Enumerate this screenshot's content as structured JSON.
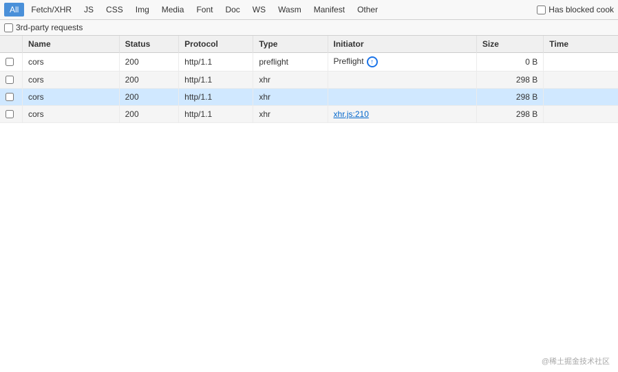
{
  "filterBar": {
    "tabs": [
      {
        "id": "all",
        "label": "All",
        "active": true
      },
      {
        "id": "fetch-xhr",
        "label": "Fetch/XHR",
        "active": false
      },
      {
        "id": "js",
        "label": "JS",
        "active": false
      },
      {
        "id": "css",
        "label": "CSS",
        "active": false
      },
      {
        "id": "img",
        "label": "Img",
        "active": false
      },
      {
        "id": "media",
        "label": "Media",
        "active": false
      },
      {
        "id": "font",
        "label": "Font",
        "active": false
      },
      {
        "id": "doc",
        "label": "Doc",
        "active": false
      },
      {
        "id": "ws",
        "label": "WS",
        "active": false
      },
      {
        "id": "wasm",
        "label": "Wasm",
        "active": false
      },
      {
        "id": "manifest",
        "label": "Manifest",
        "active": false
      },
      {
        "id": "other",
        "label": "Other",
        "active": false
      }
    ],
    "hasBlockedCookieLabel": "Has blocked cook",
    "thirdPartyLabel": "3rd-party requests"
  },
  "table": {
    "columns": [
      {
        "id": "name",
        "label": "Name"
      },
      {
        "id": "status",
        "label": "Status"
      },
      {
        "id": "protocol",
        "label": "Protocol"
      },
      {
        "id": "type",
        "label": "Type"
      },
      {
        "id": "initiator",
        "label": "Initiator"
      },
      {
        "id": "size",
        "label": "Size"
      },
      {
        "id": "time",
        "label": "Time"
      }
    ],
    "rows": [
      {
        "id": 1,
        "name": "cors",
        "status": "200",
        "protocol": "http/1.1",
        "type": "preflight",
        "initiator": "Preflight",
        "hasInitiatorIcon": true,
        "initiatorLink": null,
        "size": "0 B",
        "time": "",
        "highlighted": false
      },
      {
        "id": 2,
        "name": "cors",
        "status": "200",
        "protocol": "http/1.1",
        "type": "xhr",
        "initiator": "",
        "hasInitiatorIcon": false,
        "initiatorLink": null,
        "size": "298 B",
        "time": "",
        "highlighted": false
      },
      {
        "id": 3,
        "name": "cors",
        "status": "200",
        "protocol": "http/1.1",
        "type": "xhr",
        "initiator": "",
        "hasInitiatorIcon": false,
        "initiatorLink": null,
        "size": "298 B",
        "time": "",
        "highlighted": true
      },
      {
        "id": 4,
        "name": "cors",
        "status": "200",
        "protocol": "http/1.1",
        "type": "xhr",
        "initiator": "xhr.js:210",
        "hasInitiatorIcon": false,
        "initiatorLink": "xhr.js:210",
        "size": "298 B",
        "time": "",
        "highlighted": false
      }
    ]
  },
  "watermark": "@稀土掘金技术社区"
}
